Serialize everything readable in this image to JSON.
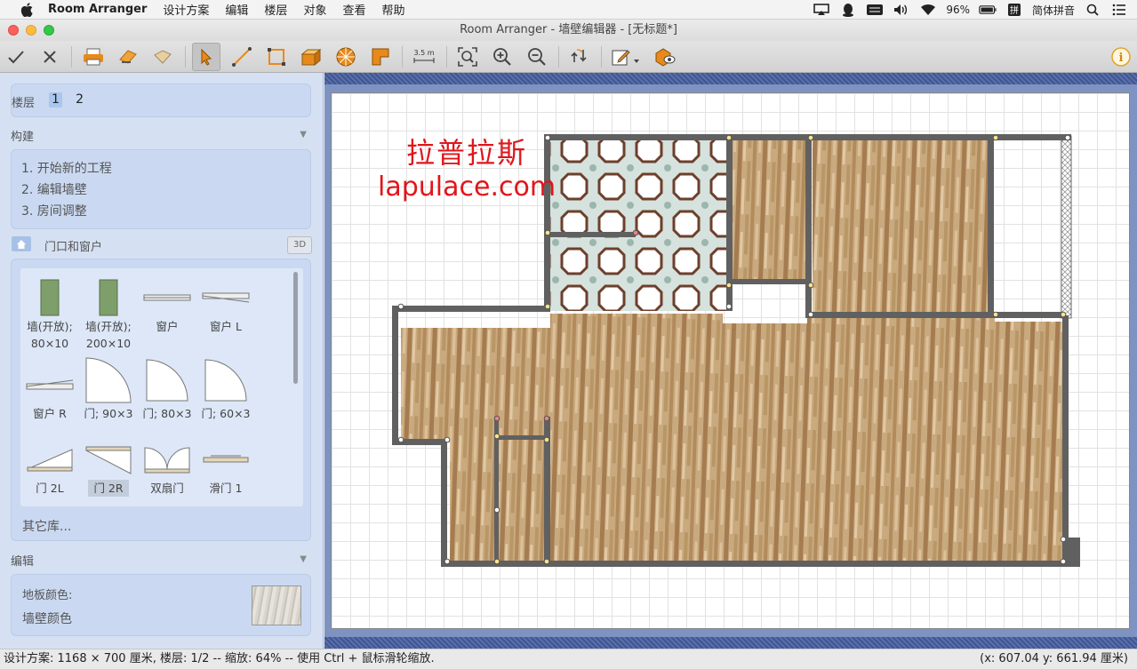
{
  "menubar": {
    "app_name": "Room Arranger",
    "items": [
      "设计方案",
      "编辑",
      "楼层",
      "对象",
      "查看",
      "帮助"
    ],
    "battery": "96%",
    "input_method": "简体拼音"
  },
  "window": {
    "title": "Room Arranger - 墙壁编辑器 - [无标题*]"
  },
  "toolbar": {
    "buttons": [
      "confirm-icon",
      "cancel-icon",
      "print-icon",
      "import-icon",
      "export-icon",
      "select-icon",
      "line-icon",
      "rectangle-icon",
      "wall-icon",
      "arc-icon",
      "corner-icon",
      "measure-icon",
      "zoom-fit-icon",
      "zoom-in-icon",
      "zoom-out-icon",
      "rotate-icon",
      "edit-icon",
      "3d-view-icon",
      "info-icon"
    ],
    "measure_label": "3.5 m"
  },
  "sidebar": {
    "floors_label": "楼层",
    "floors": [
      "1",
      "2"
    ],
    "build_section": "构建",
    "steps": [
      "1. 开始新的工程",
      "2. 编辑墙壁",
      "3. 房间调整"
    ],
    "doors_section": "门口和窗户",
    "btn_3d": "3D",
    "library": [
      {
        "line1": "墙(开放);",
        "line2": "80×10"
      },
      {
        "line1": "墙(开放);",
        "line2": "200×10"
      },
      {
        "line1": "窗户",
        "line2": ""
      },
      {
        "line1": "窗户 L",
        "line2": ""
      },
      {
        "line1": "窗户 R",
        "line2": ""
      },
      {
        "line1": "门; 90×3",
        "line2": ""
      },
      {
        "line1": "门; 80×3",
        "line2": ""
      },
      {
        "line1": "门; 60×3",
        "line2": ""
      },
      {
        "line1": "门 2L",
        "line2": ""
      },
      {
        "line1": "门 2R",
        "line2": ""
      },
      {
        "line1": "双扇门",
        "line2": ""
      },
      {
        "line1": "滑门 1",
        "line2": ""
      }
    ],
    "other_libs": "其它库...",
    "edit_section": "编辑",
    "floor_color": "地板颜色:",
    "wall_color": "墙壁颜色"
  },
  "canvas": {
    "watermark_cn": "拉普拉斯",
    "watermark_en": "lapulace.com"
  },
  "statusbar": {
    "left": "设计方案: 1168 × 700 厘米, 楼层: 1/2 -- 缩放: 64% -- 使用 Ctrl + 鼠标滑轮缩放.",
    "right": "(x: 607.04 y: 661.94 厘米)"
  }
}
